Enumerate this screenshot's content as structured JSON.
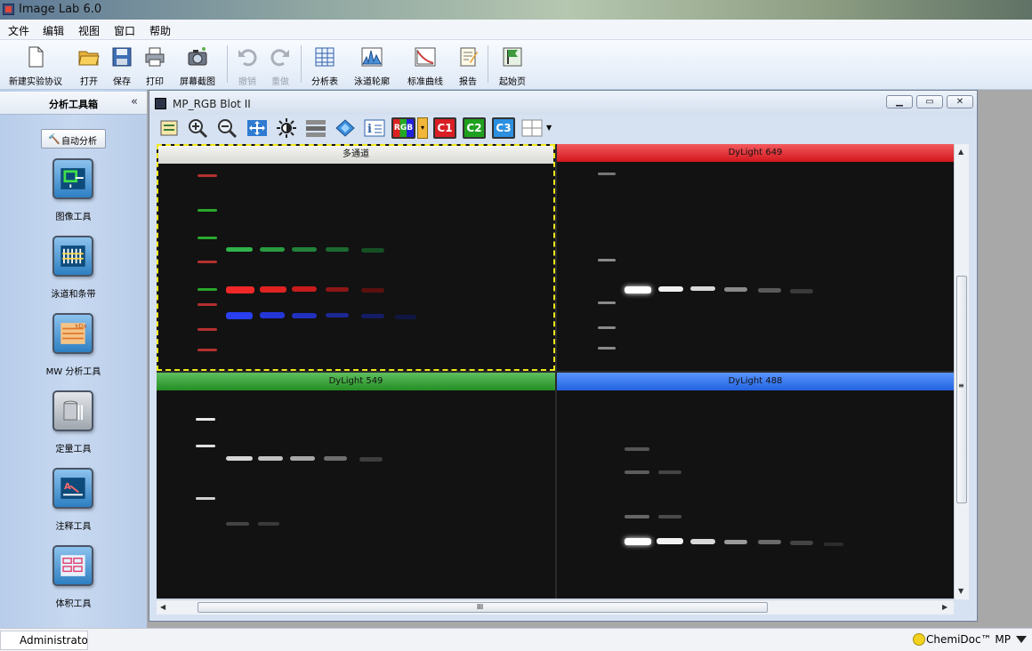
{
  "window": {
    "title": "Image Lab 6.0"
  },
  "menu": [
    "文件",
    "编辑",
    "视图",
    "窗口",
    "帮助"
  ],
  "toolbar": {
    "items": [
      {
        "label": "新建实验协议",
        "icon": "new-document-icon",
        "enabled": true
      },
      {
        "label": "打开",
        "icon": "open-folder-icon",
        "enabled": true
      },
      {
        "label": "保存",
        "icon": "save-disk-icon",
        "enabled": true
      },
      {
        "label": "打印",
        "icon": "printer-icon",
        "enabled": true
      },
      {
        "label": "屏幕截图",
        "icon": "camera-icon",
        "enabled": true
      },
      {
        "label": "撤销",
        "icon": "undo-icon",
        "enabled": false
      },
      {
        "label": "重做",
        "icon": "redo-icon",
        "enabled": false
      },
      {
        "label": "分析表",
        "icon": "table-icon",
        "enabled": true
      },
      {
        "label": "泳道轮廓",
        "icon": "lane-profile-icon",
        "enabled": true
      },
      {
        "label": "标准曲线",
        "icon": "standard-curve-icon",
        "enabled": true
      },
      {
        "label": "报告",
        "icon": "report-icon",
        "enabled": true
      },
      {
        "label": "起始页",
        "icon": "start-page-icon",
        "enabled": true
      }
    ]
  },
  "left_panel": {
    "title": "分析工具箱",
    "collapse_label": "«",
    "auto_button": "自动分析",
    "tools": [
      {
        "label": "图像工具",
        "icon": "image-tools-icon"
      },
      {
        "label": "泳道和条带",
        "icon": "lanes-bands-icon"
      },
      {
        "label": "MW 分析工具",
        "icon": "mw-analysis-icon"
      },
      {
        "label": "定量工具",
        "icon": "quantity-tools-icon"
      },
      {
        "label": "注释工具",
        "icon": "annotation-tools-icon"
      },
      {
        "label": "体积工具",
        "icon": "volume-tools-icon"
      }
    ]
  },
  "document": {
    "title": "MP_RGB Blot II",
    "buttons": [
      "minimize",
      "restore",
      "close"
    ],
    "image_tools": [
      "image-transform-icon",
      "zoom-in-icon",
      "zoom-out-icon",
      "fit-window-icon",
      "brightness-icon",
      "lanes-toggle-icon",
      "3d-view-icon",
      "image-info-icon",
      "RGB",
      "C1",
      "C2",
      "C3",
      "layout-icon"
    ],
    "channel_buttons": {
      "rgb": "RGB",
      "c1": "C1",
      "c2": "C2",
      "c3": "C3"
    },
    "panes": [
      {
        "label": "多通道",
        "header_color": "#ececea"
      },
      {
        "label": "DyLight 649",
        "header_color": "#e5262d"
      },
      {
        "label": "DyLight 549",
        "header_color": "#2f9a2f"
      },
      {
        "label": "DyLight 488",
        "header_color": "#2f6ee5"
      }
    ],
    "hscroll_mark": "III",
    "vscroll_mark": "≡"
  },
  "status": {
    "user": "Administrator",
    "device": "ChemiDoc™ MP"
  },
  "colors": {
    "accent": "#2f6ee5",
    "selection": "#f0e81a"
  }
}
